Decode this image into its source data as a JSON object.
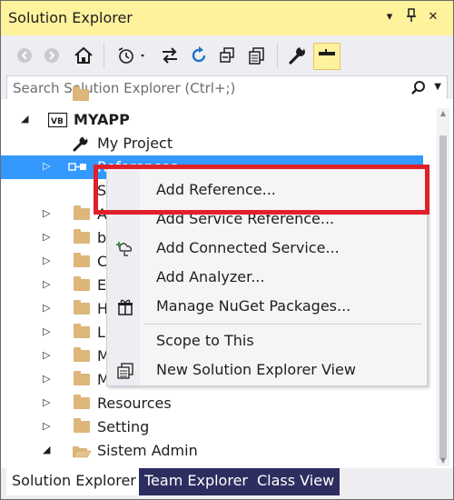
{
  "window": {
    "title": "Solution Explorer",
    "pin_glyph": "▾",
    "pin2_glyph": "ᵽ",
    "close_glyph": "✕"
  },
  "search": {
    "placeholder": "Search Solution Explorer (Ctrl+;)"
  },
  "tree": {
    "items": [
      {
        "label": "MYAPP",
        "level": 0,
        "expander": "◢",
        "icon": "vb-project-icon"
      },
      {
        "label": "My Project",
        "level": 1,
        "expander": "",
        "icon": "wrench-icon"
      },
      {
        "label": "References",
        "level": 1,
        "expander": "▷",
        "icon": "references-icon",
        "selected": true
      },
      {
        "label": "S",
        "level": 1,
        "expander": "",
        "icon": "folder-icon"
      },
      {
        "label": "A",
        "level": 1,
        "expander": "▷",
        "icon": "folder-icon"
      },
      {
        "label": "b",
        "level": 1,
        "expander": "▷",
        "icon": "folder-icon"
      },
      {
        "label": "C",
        "level": 1,
        "expander": "▷",
        "icon": "folder-icon"
      },
      {
        "label": "E",
        "level": 1,
        "expander": "▷",
        "icon": "folder-icon"
      },
      {
        "label": "H",
        "level": 1,
        "expander": "▷",
        "icon": "folder-icon"
      },
      {
        "label": "L",
        "level": 1,
        "expander": "▷",
        "icon": "folder-icon"
      },
      {
        "label": "M",
        "level": 1,
        "expander": "▷",
        "icon": "folder-icon"
      },
      {
        "label": "M",
        "level": 1,
        "expander": "▷",
        "icon": "folder-icon"
      },
      {
        "label": "Resources",
        "level": 1,
        "expander": "▷",
        "icon": "folder-icon"
      },
      {
        "label": "Setting",
        "level": 1,
        "expander": "▷",
        "icon": "folder-icon"
      },
      {
        "label": "Sistem Admin",
        "level": 1,
        "expander": "◢",
        "icon": "folder-open-icon"
      }
    ]
  },
  "context_menu": {
    "items": [
      {
        "label": "Add Reference...",
        "icon": ""
      },
      {
        "label": "Add Service Reference...",
        "icon": ""
      },
      {
        "label": "Add Connected Service...",
        "icon": "connected-service-icon"
      },
      {
        "label": "Add Analyzer...",
        "icon": ""
      },
      {
        "label": "Manage NuGet Packages...",
        "icon": "nuget-icon"
      },
      {
        "label": "Scope to This",
        "icon": ""
      },
      {
        "label": "New Solution Explorer View",
        "icon": "new-view-icon"
      }
    ],
    "highlighted": "Add Reference..."
  },
  "tabs": [
    {
      "label": "Solution Explorer",
      "active": true
    },
    {
      "label": "Team Explorer",
      "active": false
    },
    {
      "label": "Class View",
      "active": false
    }
  ],
  "colors": {
    "title_bar": "#fff29d",
    "selection": "#3399ff",
    "highlight_box": "#e0202a",
    "inactive_tab": "#2d2d60"
  }
}
